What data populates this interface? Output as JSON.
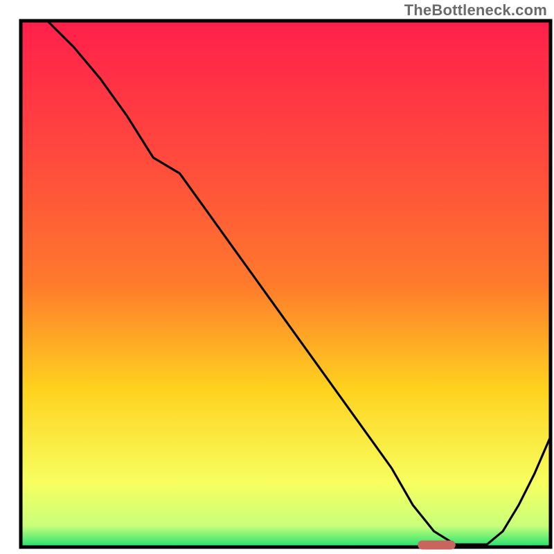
{
  "watermark": "TheBottleneck.com",
  "colors": {
    "gradient_top": "#ff1f4b",
    "gradient_q1": "#ff7a2c",
    "gradient_mid": "#ffd21f",
    "gradient_q3": "#f7ff60",
    "gradient_bottom": "#20e070",
    "axis": "#000000",
    "curve": "#000000",
    "marker_fill": "#c9645e",
    "marker_stroke": "#c9645e"
  },
  "chart_data": {
    "type": "line",
    "title": "",
    "xlabel": "",
    "ylabel": "",
    "xlim": [
      0,
      100
    ],
    "ylim": [
      0,
      100
    ],
    "x": [
      5,
      10,
      15,
      20,
      25,
      30,
      35,
      40,
      45,
      50,
      55,
      60,
      65,
      70,
      74,
      78,
      82,
      85,
      88,
      91,
      94,
      97,
      100
    ],
    "values": [
      100,
      95,
      89,
      82,
      74,
      71,
      64,
      57,
      50,
      43,
      36,
      29,
      22,
      15,
      8,
      3,
      0.5,
      0.5,
      0.5,
      3,
      8,
      14,
      21
    ],
    "marker": {
      "x_start": 75,
      "x_end": 82,
      "y": 0.4
    },
    "grid": false,
    "legend": false
  }
}
